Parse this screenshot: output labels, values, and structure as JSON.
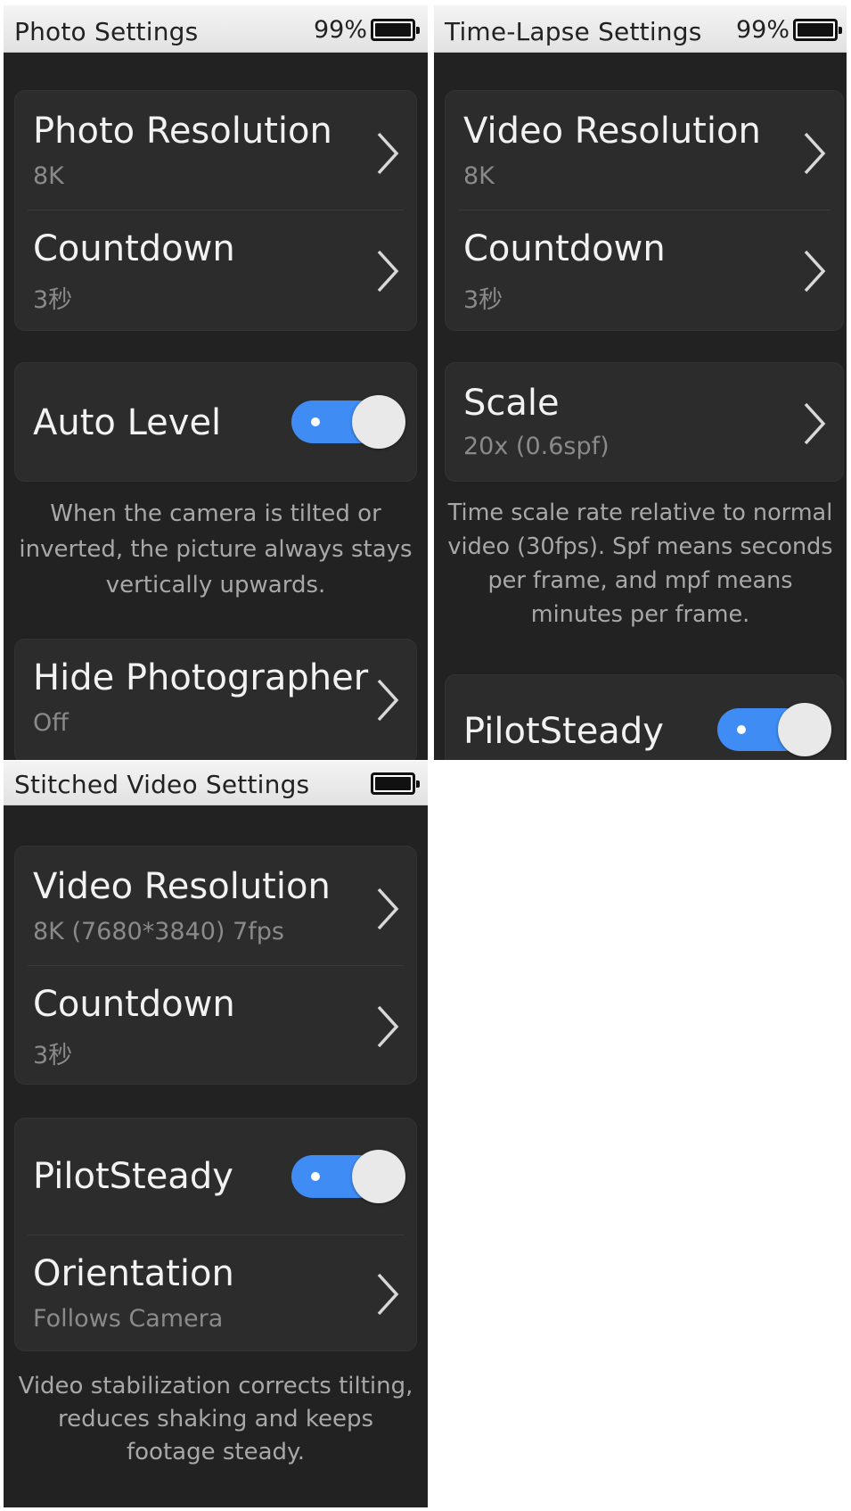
{
  "screens": [
    {
      "title": "Photo Settings",
      "battery": "99%",
      "group1": [
        {
          "label": "Photo Resolution",
          "value": "8K"
        },
        {
          "label": "Countdown",
          "value": "3秒"
        }
      ],
      "toggle": {
        "label": "Auto Level",
        "on": true
      },
      "description": "When the camera is tilted or inverted, the picture always stays vertically upwards.",
      "group3": [
        {
          "label": "Hide Photographer",
          "value": "Off"
        }
      ]
    },
    {
      "title": "Time-Lapse Settings",
      "battery": "99%",
      "group1": [
        {
          "label": "Video Resolution",
          "value": "8K"
        },
        {
          "label": "Countdown",
          "value": "3秒"
        }
      ],
      "scale": {
        "label": "Scale",
        "value": "20x (0.6spf)"
      },
      "description": "Time scale rate relative to normal video (30fps). Spf means seconds per frame, and mpf means minutes per frame.",
      "toggle": {
        "label": "PilotSteady",
        "on": true
      }
    },
    {
      "title": "Stitched Video Settings",
      "group1": [
        {
          "label": "Video Resolution",
          "value": "8K (7680*3840) 7fps"
        },
        {
          "label": "Countdown",
          "value": "3秒"
        }
      ],
      "toggle": {
        "label": "PilotSteady",
        "on": true
      },
      "orientation": {
        "label": "Orientation",
        "value": "Follows Camera"
      },
      "description": "Video stabilization corrects tilting, reduces shaking and keeps footage steady."
    }
  ],
  "icons": {
    "chevron": "chevron-right-icon",
    "battery": "battery-icon"
  },
  "colors": {
    "background": "#222222",
    "card": "#2c2c2c",
    "toggle_on": "#3f8cf5",
    "label": "#f2f2f2",
    "value": "#8a8a8a"
  }
}
